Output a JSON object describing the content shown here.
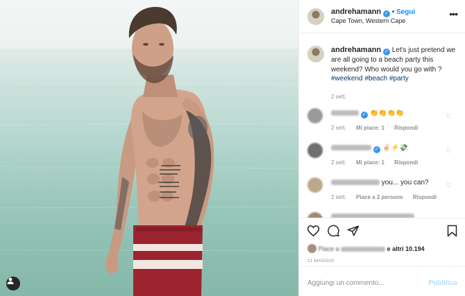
{
  "post": {
    "username": "andrehamann",
    "follow_label": "Segui",
    "location": "Cape Town, Western Cape",
    "caption": {
      "text": "Let's just pretend we are all going to a beach party this weekend? Who would you go with ?",
      "hashtags": [
        "#weekend",
        "#beach",
        "#party"
      ],
      "age": "2 sett."
    },
    "comments": [
      {
        "text": "",
        "emoji": "👏👏👏👏",
        "age": "2 sett.",
        "likes_label": "Mi piace: 1",
        "reply_label": "Rispondi"
      },
      {
        "text": "",
        "emoji": "✌🏻⚡💸",
        "age": "2 sett.",
        "likes_label": "Mi piace: 1",
        "reply_label": "Rispondi"
      },
      {
        "text": " you... you can?",
        "emoji": "",
        "age": "2 sett.",
        "likes_label": "Piace a 2 persone",
        "reply_label": "Rispondi"
      }
    ],
    "likes_suffix": "e altri 10.194",
    "likes_prefix": "Piace a",
    "date": "21 MAGGIO",
    "comment_placeholder": "Aggiungi un commento...",
    "post_label": "Pubblica"
  },
  "icons": {
    "more": "more-options-icon",
    "like": "heart-icon",
    "comment": "comment-icon",
    "share": "share-icon",
    "save": "bookmark-icon",
    "tag": "user-tag-icon"
  },
  "colors": {
    "link": "#00376b",
    "accent": "#0095f6",
    "verified": "#3897f0"
  }
}
